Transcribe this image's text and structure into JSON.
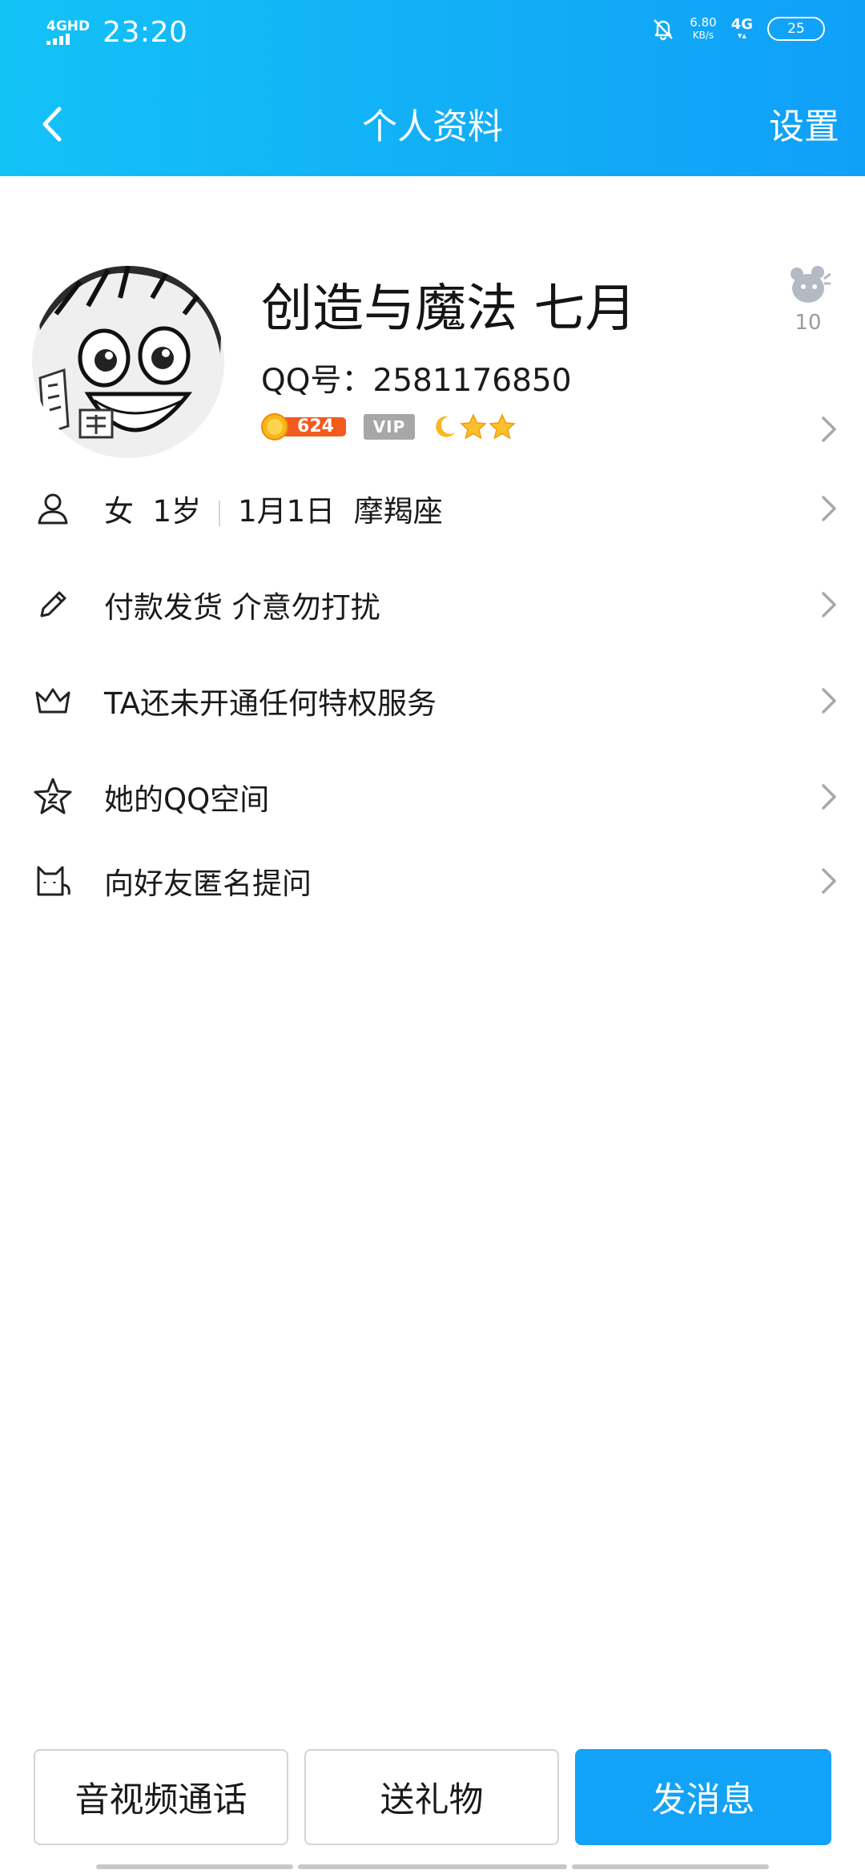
{
  "status_bar": {
    "network_gen": "4GHD",
    "time": "23:20",
    "speed_value": "6.80",
    "speed_unit": "KB/s",
    "mobile": "4G",
    "battery": "25"
  },
  "nav": {
    "title": "个人资料",
    "settings": "设置"
  },
  "profile": {
    "name": "创造与魔法 七月",
    "qq_label": "QQ号：",
    "qq_number": "2581176850",
    "coin_value": "624",
    "vip_label": "VIP",
    "like_count": "10"
  },
  "rows": [
    {
      "icon": "person-icon",
      "parts": [
        "女",
        "1岁",
        "1月1日",
        "摩羯座"
      ]
    },
    {
      "icon": "pencil-icon",
      "label": "付款发货 介意勿打扰"
    },
    {
      "icon": "crown-icon",
      "label": "TA还未开通任何特权服务"
    },
    {
      "icon": "star-z-icon",
      "label": "她的QQ空间"
    },
    {
      "icon": "cat-icon",
      "label": "向好友匿名提问"
    }
  ],
  "actions": {
    "call": "音视频通话",
    "gift": "送礼物",
    "message": "发消息"
  },
  "colors": {
    "header_from": "#13c2f7",
    "header_to": "#10a0f8",
    "primary_button": "#12a2f7",
    "chevron": "#a8a8a8",
    "vip_badge": "#a7a7a7"
  }
}
